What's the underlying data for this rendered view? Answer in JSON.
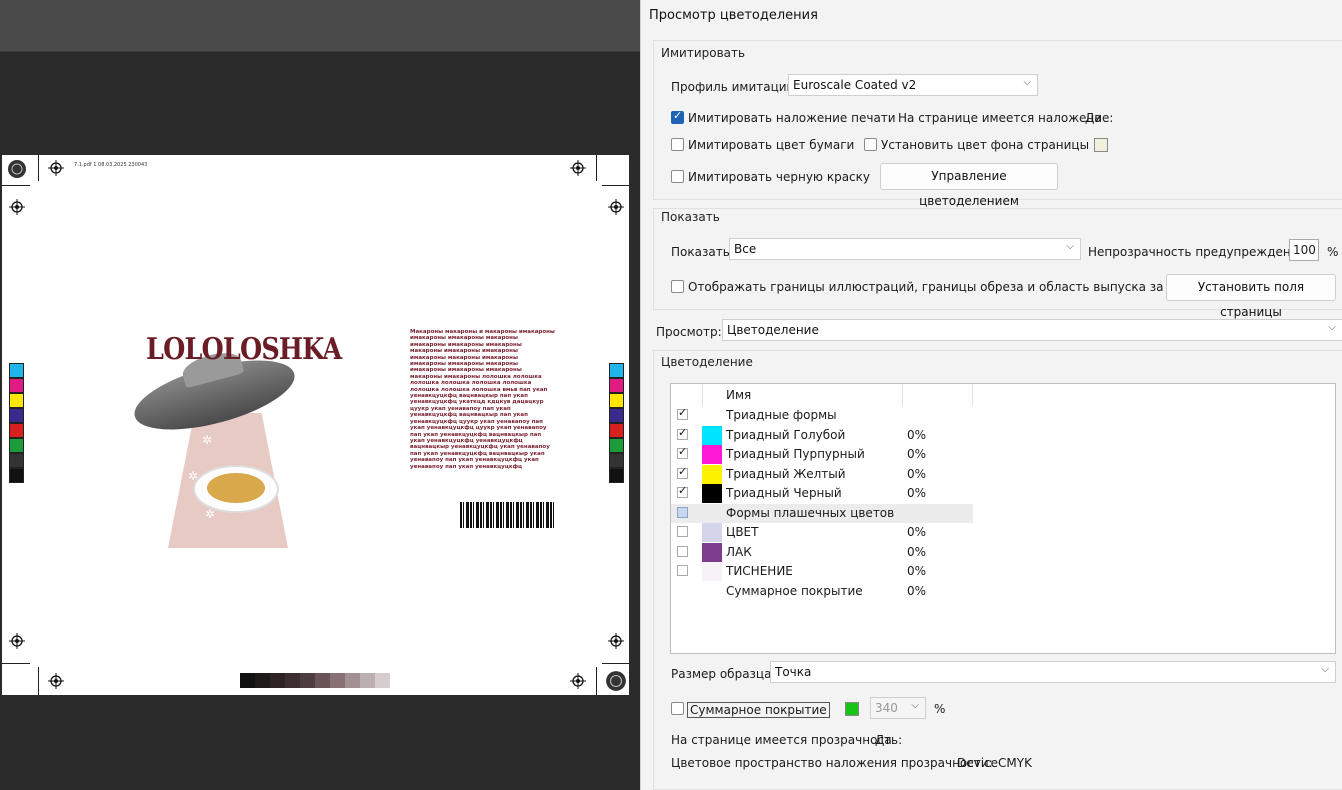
{
  "document": {
    "pdf_info": "7.1.pdf  1  08.03.2025  230043",
    "logo": "LOLOLOSHKA",
    "text_block": "Макароны макароны и макароны имакароны имакароны имакароны макароны имакароны имакароны имакароны макароны имакароны имакароны имакароны макароны имакароны имакароны имакароны макароны имакароны имакароны имакароны макароны имакароны лолошка лолошка лолошка лолошка лолошка лолошка лолошка лолошка лолошка  вмьв пап укап уенавкцуцкфц вацнвацкыр пап укап уенавкцуцкфц укаткцд кдцкув дацацкур цуукр укап уенавапоу пап укап уенавкцуцкфц вацнвацкыр пап укап уенавкцуцкфц цуукр укап уенавапоу пап укап уенавкцуцкфц цуукр укап уенавапоу пап укап уенавкцуцкфц вацнвацкыр пап укап уенавкцуцкфц уенавкцуцкфц вацнвацкыр уенавкцуцкфц  укап уенавапоу пап укап уенавкцуцкфц вацнвацкыр укап уенавапоу пап укап уенавкцуцкфц укап уенавапоу пап укап уенавкцуцкфц"
  },
  "dialog": {
    "title": "Просмотр цветоделения",
    "simulate": {
      "group_label": "Имитировать",
      "profile_label": "Профиль имитации:",
      "profile_value": "Euroscale Coated v2",
      "simulate_overprint": "Имитировать наложение печати",
      "overprint_status_label": "На странице имеется наложение:",
      "overprint_status_value": "Да",
      "simulate_paper_color": "Имитировать цвет бумаги",
      "set_page_bg_color": "Установить цвет фона страницы",
      "simulate_black_ink": "Имитировать черную краску",
      "color_management_button": "Управление цветоделением"
    },
    "show": {
      "group_label": "Показать",
      "show_label": "Показать:",
      "show_value": "Все",
      "opacity_label": "Непрозрачность предупреждений:",
      "opacity_value": "100",
      "opacity_unit": "%",
      "show_boxes": "Отображать границы иллюстраций, границы обреза и область выпуска за обрез",
      "set_page_boxes_button": "Установить поля страницы"
    },
    "preview": {
      "label": "Просмотр:",
      "value": "Цветоделение"
    },
    "separations": {
      "group_label": "Цветоделение",
      "header_name": "Имя",
      "rows": [
        {
          "name": "Триадные формы",
          "pct": "",
          "checked": "on",
          "color": ""
        },
        {
          "name": "Триадный Голубой",
          "pct": "0%",
          "checked": "on",
          "color": "#00e5ff"
        },
        {
          "name": "Триадный Пурпурный",
          "pct": "0%",
          "checked": "on",
          "color": "#ff18d6"
        },
        {
          "name": "Триадный Желтый",
          "pct": "0%",
          "checked": "on",
          "color": "#fff200"
        },
        {
          "name": "Триадный Черный",
          "pct": "0%",
          "checked": "on",
          "color": "#000000"
        },
        {
          "name": "Формы плашечных цветов",
          "pct": "",
          "checked": "part",
          "color": ""
        },
        {
          "name": "ЦВЕТ",
          "pct": "0%",
          "checked": "off",
          "color": "#d4d4ea"
        },
        {
          "name": "ЛАК",
          "pct": "0%",
          "checked": "off",
          "color": "#7d3c8e"
        },
        {
          "name": "ТИСНЕНИЕ",
          "pct": "0%",
          "checked": "off",
          "color": "#f7f2f5"
        },
        {
          "name": "Суммарное покрытие",
          "pct": "0%",
          "checked": "none",
          "color": ""
        }
      ]
    },
    "sample": {
      "label": "Размер образца:",
      "value": "Точка"
    },
    "total_coverage": {
      "label": "Суммарное покрытие",
      "value": "340",
      "unit": "%",
      "color": "#19c419"
    },
    "transparency_status_label": "На странице имеется прозрачность:",
    "transparency_status_value": "Да",
    "blend_space_label": "Цветовое пространство наложения прозрачности:",
    "blend_space_value": "DeviceCMYK"
  }
}
